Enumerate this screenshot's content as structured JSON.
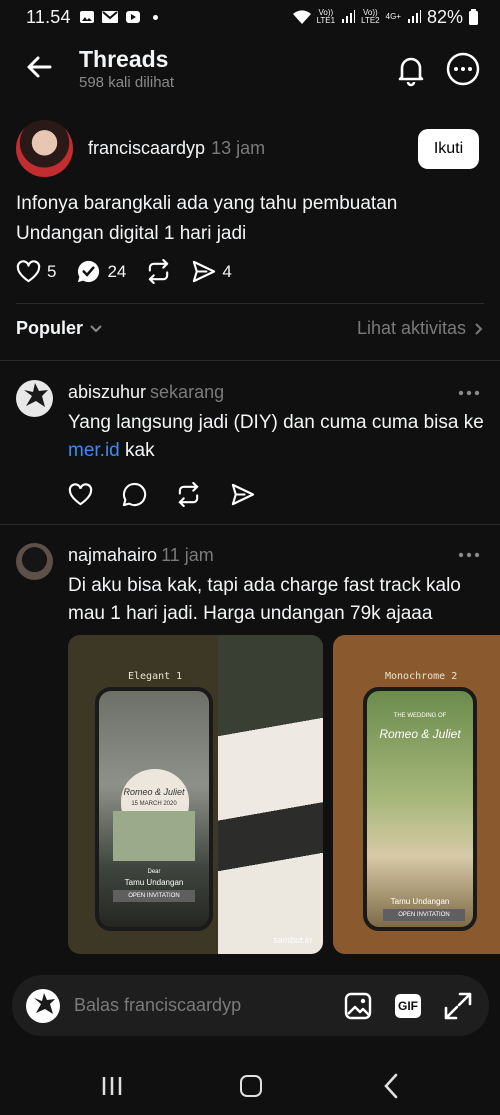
{
  "status_bar": {
    "time": "11.54",
    "battery": "82%",
    "network1": "LTE1",
    "network2": "LTE2",
    "net_type": "4G+",
    "volte": "Vo))"
  },
  "header": {
    "title": "Threads",
    "subtitle": "598 kali dilihat"
  },
  "post": {
    "username": "franciscaardyp",
    "time": "13 jam",
    "follow_label": "Ikuti",
    "text": "Infonya barangkali ada yang tahu pembuatan Undangan digital 1 hari jadi",
    "likes": "5",
    "reposts": "24",
    "shares": "4"
  },
  "activity": {
    "sort_label": "Populer",
    "link_label": "Lihat aktivitas"
  },
  "replies": [
    {
      "username": "abiszuhur",
      "time": "sekarang",
      "text_before": "Yang langsung jadi (DIY) dan cuma cuma bisa ke ",
      "link": "mer.id",
      "text_after": " kak"
    },
    {
      "username": "najmahairo",
      "time": "11 jam",
      "text": "Di aku bisa kak, tapi ada charge fast track kalo mau 1 hari jadi. Harga undangan 79k ajaaa",
      "images": [
        {
          "label": "Elegant 1",
          "names": "Romeo & Juliet",
          "date": "15 MARCH 2020",
          "to_label": "Dear",
          "guest": "Tamu Undangan",
          "button": "OPEN INVITATION",
          "watermark": "sambut.in"
        },
        {
          "label": "Monochrome 2",
          "heading": "THE WEDDING OF",
          "names": "Romeo & Juliet",
          "guest": "Tamu Undangan",
          "button": "OPEN INVITATION"
        }
      ]
    }
  ],
  "reply_bar": {
    "placeholder": "Balas franciscaardyp",
    "gif_label": "GIF"
  },
  "colors": {
    "background": "#101010",
    "link": "#3c8bf0",
    "muted": "#7a7a7a"
  }
}
